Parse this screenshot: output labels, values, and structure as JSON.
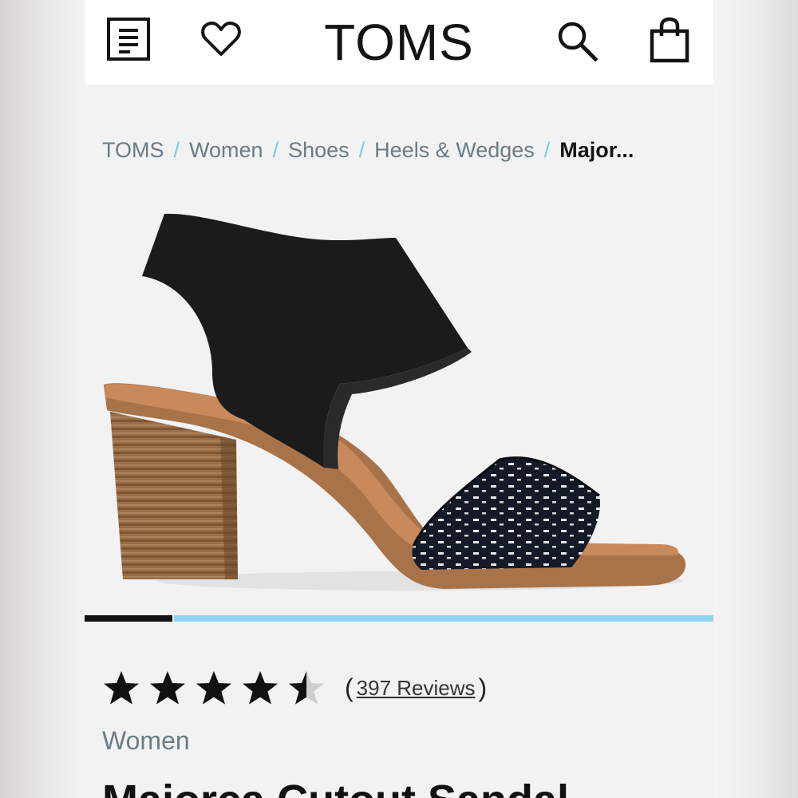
{
  "header": {
    "brand": "TOMS",
    "menu_icon": "menu-icon",
    "wishlist_icon": "heart-icon",
    "search_icon": "search-icon",
    "cart_icon": "shopping-bag-icon"
  },
  "breadcrumb": {
    "items": [
      "TOMS",
      "Women",
      "Shoes",
      "Heels & Wedges"
    ],
    "current": "Major...",
    "separator": "/"
  },
  "carousel": {
    "active_index": 1,
    "progress_fraction": 0.14
  },
  "product": {
    "rating": 4.5,
    "rating_max": 5,
    "reviews_label": "397 Reviews",
    "paren_open": "(",
    "paren_close": ")",
    "category": "Women",
    "title": "Majorca Cutout Sandal"
  },
  "colors": {
    "accent": "#8dd3f0",
    "text_muted": "#6a7c86",
    "separator": "#7cc6e8"
  }
}
